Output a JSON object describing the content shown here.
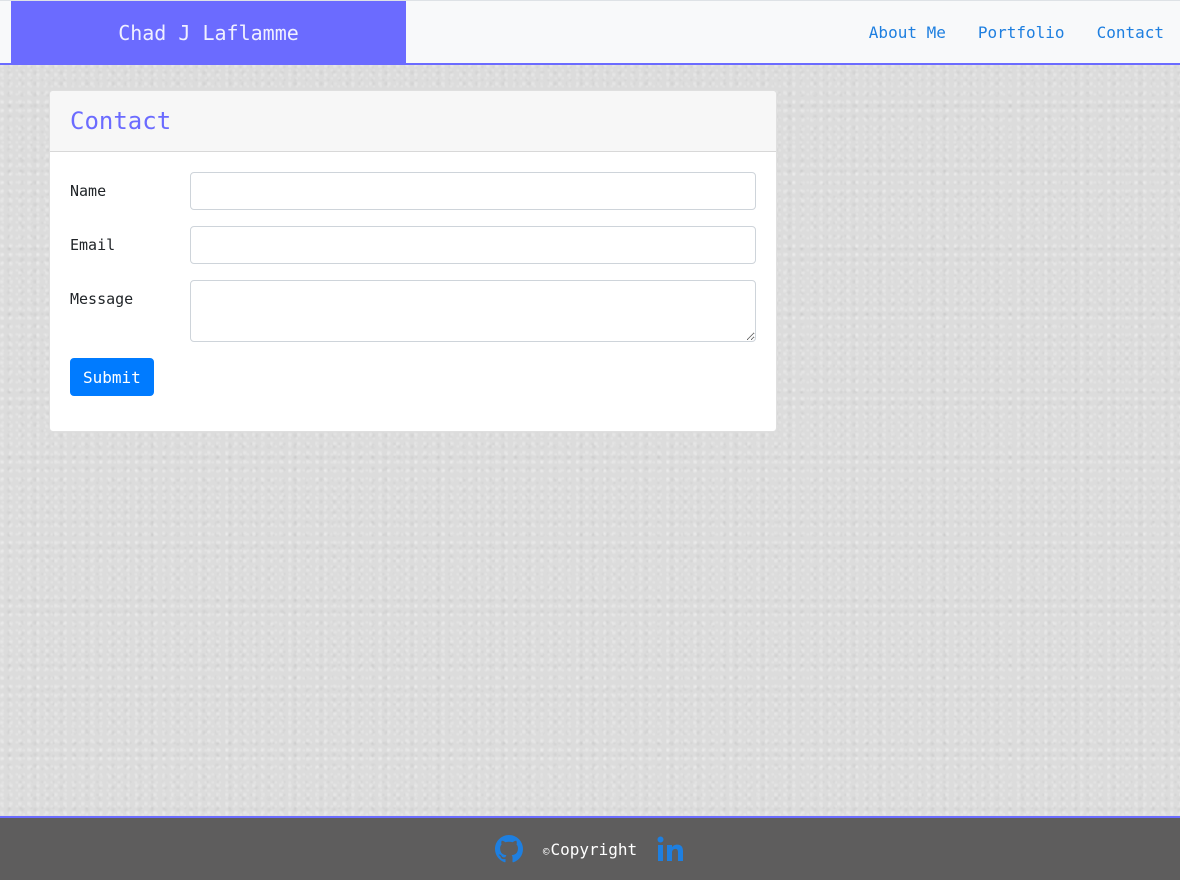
{
  "navbar": {
    "brand": "Chad J Laflamme",
    "links": [
      "About Me",
      "Portfolio",
      "Contact"
    ]
  },
  "contact_card": {
    "title": "Contact",
    "fields": {
      "name": {
        "label": "Name",
        "value": ""
      },
      "email": {
        "label": "Email",
        "value": ""
      },
      "message": {
        "label": "Message",
        "value": ""
      }
    },
    "submit_label": "Submit"
  },
  "footer": {
    "copyright_symbol": "©",
    "copyright_text": "Copyright",
    "icons": [
      "github-icon",
      "linkedin-icon"
    ]
  },
  "colors": {
    "brand": "#6b6bff",
    "nav_link": "#1e7fe0",
    "button": "#007bff",
    "footer_bg": "#5e5d5d"
  }
}
